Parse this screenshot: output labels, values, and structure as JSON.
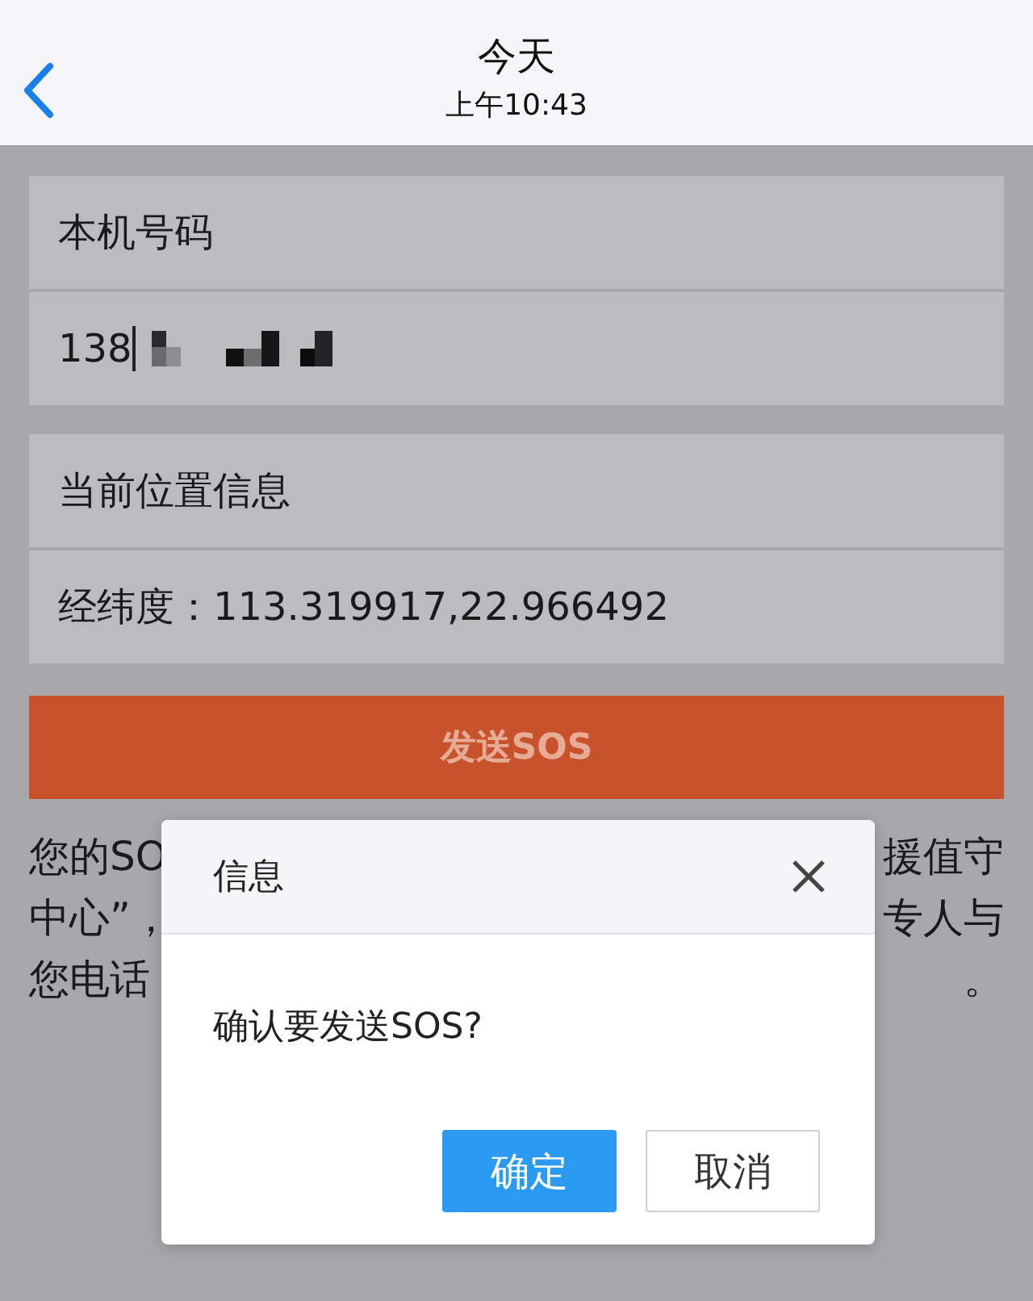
{
  "nav_bar": {
    "title": "今天",
    "subtitle": "上午10:43"
  },
  "phone_section": {
    "label": "本机号码",
    "value": "138"
  },
  "location_section": {
    "label": "当前位置信息",
    "value": "经纬度：113.319917,22.966492"
  },
  "send_button": {
    "label": "发送SOS"
  },
  "notice_lines": [
    {
      "left": "您的SO",
      "right": "援值守"
    },
    {
      "left": "中心”，",
      "right": "专人与"
    },
    {
      "left": "您电话",
      "right": "。"
    }
  ],
  "dialog": {
    "title": "信息",
    "message": "确认要发送SOS?",
    "buttons": [
      {
        "label": "确定",
        "kind": "primary"
      },
      {
        "label": "取消",
        "kind": "secondary"
      }
    ]
  }
}
